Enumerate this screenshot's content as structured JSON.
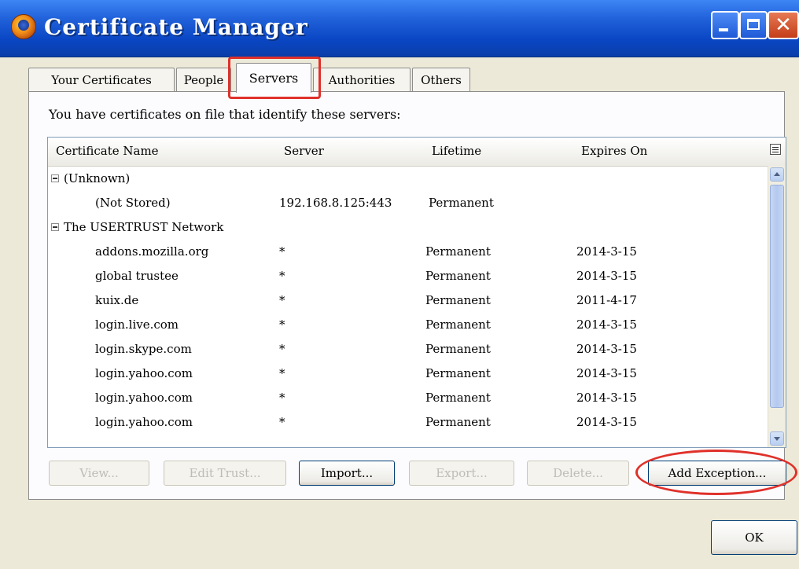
{
  "window": {
    "title": "Certificate Manager"
  },
  "tabs": [
    {
      "label": "Your Certificates",
      "active": false
    },
    {
      "label": "People",
      "active": false
    },
    {
      "label": "Servers",
      "active": true
    },
    {
      "label": "Authorities",
      "active": false
    },
    {
      "label": "Others",
      "active": false
    }
  ],
  "panel": {
    "description": "You have certificates on file that identify these servers:"
  },
  "columns": [
    "Certificate Name",
    "Server",
    "Lifetime",
    "Expires On"
  ],
  "tree": {
    "group1": {
      "label": "(Unknown)",
      "rows": [
        {
          "name": "(Not Stored)",
          "server": "192.168.8.125:443",
          "lifetime": "Permanent",
          "expires": ""
        }
      ]
    },
    "group2": {
      "label": "The USERTRUST Network",
      "rows": [
        {
          "name": "addons.mozilla.org",
          "server": "*",
          "lifetime": "Permanent",
          "expires": "2014-3-15"
        },
        {
          "name": "global trustee",
          "server": "*",
          "lifetime": "Permanent",
          "expires": "2014-3-15"
        },
        {
          "name": "kuix.de",
          "server": "*",
          "lifetime": "Permanent",
          "expires": "2011-4-17"
        },
        {
          "name": "login.live.com",
          "server": "*",
          "lifetime": "Permanent",
          "expires": "2014-3-15"
        },
        {
          "name": "login.skype.com",
          "server": "*",
          "lifetime": "Permanent",
          "expires": "2014-3-15"
        },
        {
          "name": "login.yahoo.com",
          "server": "*",
          "lifetime": "Permanent",
          "expires": "2014-3-15"
        },
        {
          "name": "login.yahoo.com",
          "server": "*",
          "lifetime": "Permanent",
          "expires": "2014-3-15"
        },
        {
          "name": "login.yahoo.com",
          "server": "*",
          "lifetime": "Permanent",
          "expires": "2014-3-15"
        }
      ]
    }
  },
  "buttons": {
    "view": "View...",
    "edit_trust": "Edit Trust...",
    "import": "Import...",
    "export": "Export...",
    "delete": "Delete...",
    "add_exception": "Add Exception...",
    "ok": "OK"
  },
  "colors": {
    "titlebar": "#0a46c4",
    "highlight": "#e0302a",
    "dialog": "#ece9d8"
  }
}
